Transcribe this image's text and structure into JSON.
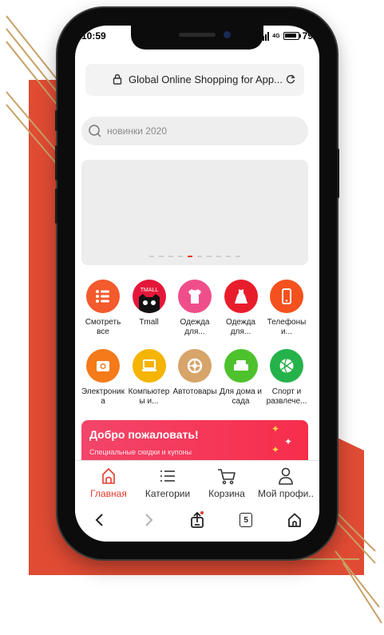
{
  "status_bar": {
    "time": "10:59",
    "network": "4G",
    "battery_level": "79"
  },
  "browser": {
    "url_title": "Global Online Shopping for App...",
    "icons": {
      "lock": "lock-icon",
      "reload": "reload-icon"
    }
  },
  "search": {
    "placeholder": "новинки 2020",
    "icon": "search-icon"
  },
  "banner": {
    "slide_count": 10,
    "active_slide": 5
  },
  "categories": [
    {
      "label": "Смотреть все",
      "icon": "list-icon",
      "color": "#f35a2c"
    },
    {
      "label": "Tmall",
      "icon": "tmall-cat-icon",
      "color": "#e4173a"
    },
    {
      "label": "Одежда для...",
      "icon": "tshirt-icon",
      "color": "#ef4e8a"
    },
    {
      "label": "Одежда для...",
      "icon": "dress-icon",
      "color": "#e81d2c"
    },
    {
      "label": "Телефоны и...",
      "icon": "phone-icon",
      "color": "#f5511e"
    },
    {
      "label": "Электроника",
      "icon": "camera-icon",
      "color": "#f47a1a"
    },
    {
      "label": "Компьютеры и...",
      "icon": "laptop-icon",
      "color": "#f5b400"
    },
    {
      "label": "Автотовары",
      "icon": "wheel-icon",
      "color": "#d7a46a"
    },
    {
      "label": "Для дома и сада",
      "icon": "sofa-icon",
      "color": "#4dc22c"
    },
    {
      "label": "Спорт и развлече...",
      "icon": "basketball-icon",
      "color": "#25b24a"
    }
  ],
  "welcome": {
    "title": "Добро пожаловать!",
    "subtitle": "Специальные скидки и купоны"
  },
  "tabbar": [
    {
      "label": "Главная",
      "icon": "home-icon",
      "active": true
    },
    {
      "label": "Категории",
      "icon": "categories-icon",
      "active": false
    },
    {
      "label": "Корзина",
      "icon": "cart-icon",
      "active": false
    },
    {
      "label": "Мой профи..",
      "icon": "profile-icon",
      "active": false
    }
  ],
  "browser_nav": {
    "tabs_count": "5"
  },
  "colors": {
    "accent": "#e43b2e",
    "background_red": "#e04b34",
    "deco_lines": "#c8a166"
  }
}
